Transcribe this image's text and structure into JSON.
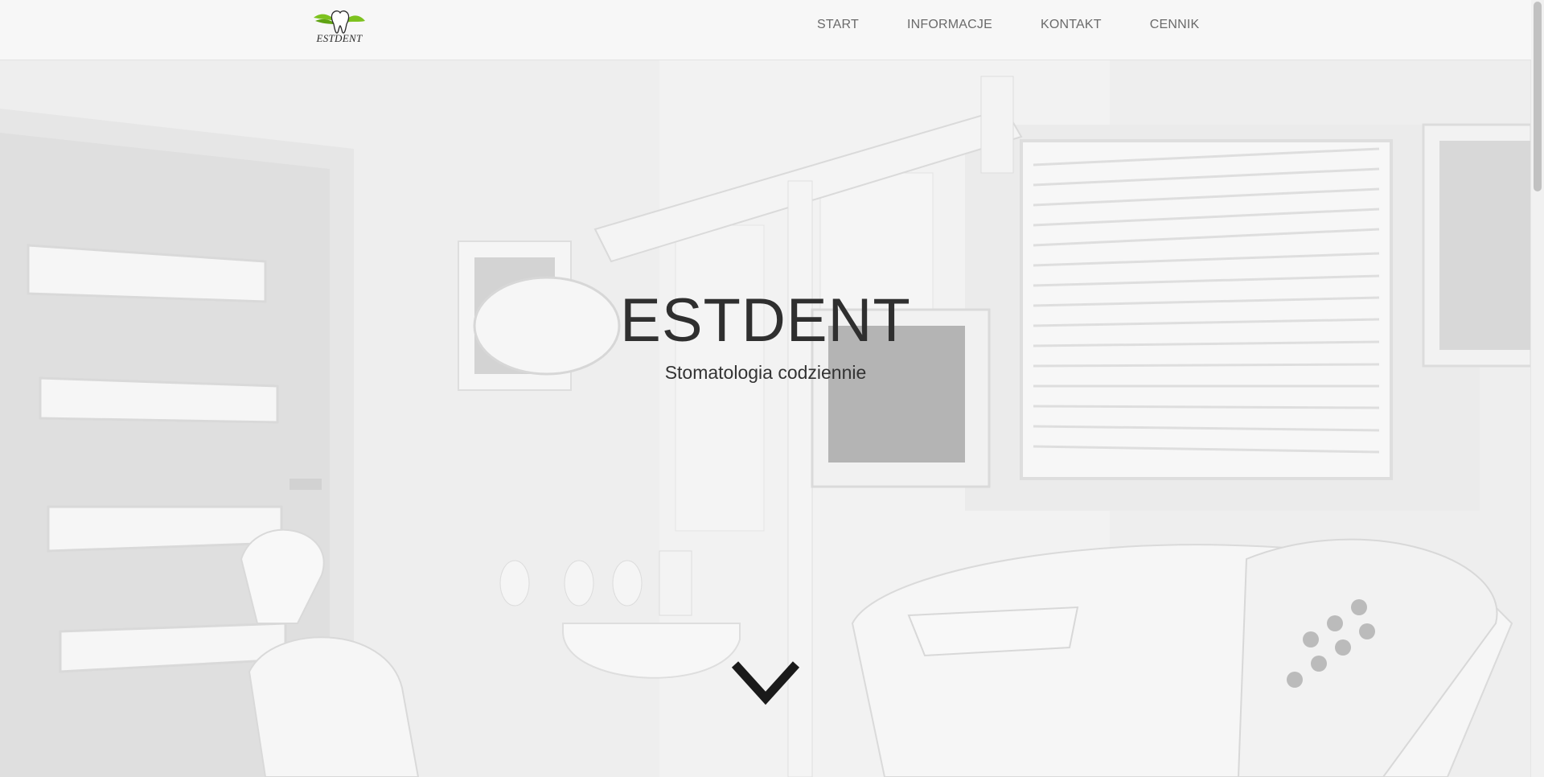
{
  "header": {
    "logo": {
      "text": "ESTDENT",
      "icon": "tooth-leaf-logo",
      "colors": {
        "leaf": "#7dc21e",
        "tooth": "#ffffff",
        "outline": "#2b2b2b"
      }
    },
    "nav": [
      {
        "label": "START"
      },
      {
        "label": "INFORMACJE"
      },
      {
        "label": "KONTAKT"
      },
      {
        "label": "CENNIK"
      }
    ]
  },
  "hero": {
    "title": "ESTDENT",
    "subtitle": "Stomatologia codziennie",
    "background": "dental-office-photo-grayscale",
    "scroll_icon": "chevron-down-icon"
  },
  "colors": {
    "header_bg": "#f7f7f7",
    "nav_text": "#6a6a6a",
    "title_text": "#2f2f2f",
    "chevron": "#1a1a1a"
  }
}
